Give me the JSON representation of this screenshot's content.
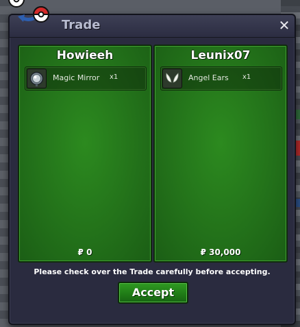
{
  "window": {
    "title": "Trade",
    "close_label": "✕"
  },
  "trade": {
    "left": {
      "player": "Howieeh",
      "items": [
        {
          "name": "Magic Mirror",
          "qty": "x1",
          "icon": "magic-mirror-icon"
        }
      ],
      "money": "₽ 0"
    },
    "right": {
      "player": "Leunix07",
      "items": [
        {
          "name": "Angel Ears",
          "qty": "x1",
          "icon": "angel-ears-icon"
        }
      ],
      "money": "₽ 30,000"
    }
  },
  "footer": {
    "notice": "Please check over the Trade carefully before accepting.",
    "accept_label": "Accept"
  },
  "colors": {
    "panel_green": "#23721a",
    "window_bg": "#2a2b3f",
    "accept_green": "#1f7a16"
  }
}
